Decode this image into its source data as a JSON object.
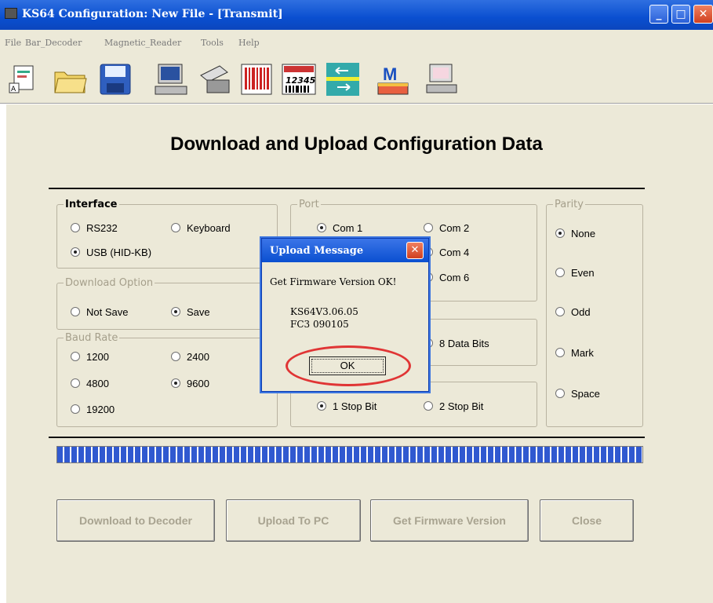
{
  "window": {
    "title": "KS64 Configuration: New File - [Transmit]"
  },
  "menu": [
    "File",
    "Bar_Decoder",
    "Magnetic_Reader",
    "Tools",
    "Help"
  ],
  "toolbar": [
    {
      "icon": "new-file-icon"
    },
    {
      "icon": "open-folder-icon"
    },
    {
      "icon": "save-disk-icon"
    },
    {
      "icon": "computer-icon"
    },
    {
      "icon": "magnetic-reader-icon"
    },
    {
      "icon": "barcode-icon"
    },
    {
      "icon": "barcode-12345-icon",
      "text": "12345"
    },
    {
      "icon": "transfer-arrows-icon"
    },
    {
      "icon": "magnetic-m-icon",
      "text": "M"
    },
    {
      "icon": "terminal-icon"
    }
  ],
  "heading": "Download and Upload Configuration Data",
  "interface": {
    "legend": "Interface",
    "options": [
      "RS232",
      "Keyboard",
      "USB (HID-KB)"
    ],
    "selected": "USB (HID-KB)"
  },
  "download_option": {
    "legend": "Download Option",
    "options": [
      "Not Save",
      "Save"
    ],
    "selected": "Save"
  },
  "baud_rate": {
    "legend": "Baud Rate",
    "options": [
      "1200",
      "2400",
      "4800",
      "9600",
      "19200"
    ],
    "selected": "9600"
  },
  "port": {
    "legend": "Port",
    "options": [
      "Com 1",
      "Com 2",
      "Com 4",
      "Com 6"
    ],
    "selected": "Com 1"
  },
  "data_bits": {
    "option": "8 Data Bits"
  },
  "stop_bits": {
    "options": [
      "1 Stop Bit",
      "2 Stop Bit"
    ],
    "selected": "1 Stop Bit"
  },
  "parity": {
    "legend": "Parity",
    "options": [
      "None",
      "Even",
      "Odd",
      "Mark",
      "Space"
    ],
    "selected": "None"
  },
  "progress": {
    "value": 1.0
  },
  "buttons": [
    "Download to Decoder",
    "Upload To PC",
    "Get Firmware Version",
    "Close"
  ],
  "dialog": {
    "title": "Upload Message",
    "message": "Get Firmware Version OK!",
    "version_line1": "KS64V3.06.05",
    "version_line2": "FC3 090105",
    "ok": "OK"
  },
  "colors": {
    "titlebar": "#0a4fd0",
    "progress": "#3059d0",
    "highlight_ring": "#e03535"
  }
}
